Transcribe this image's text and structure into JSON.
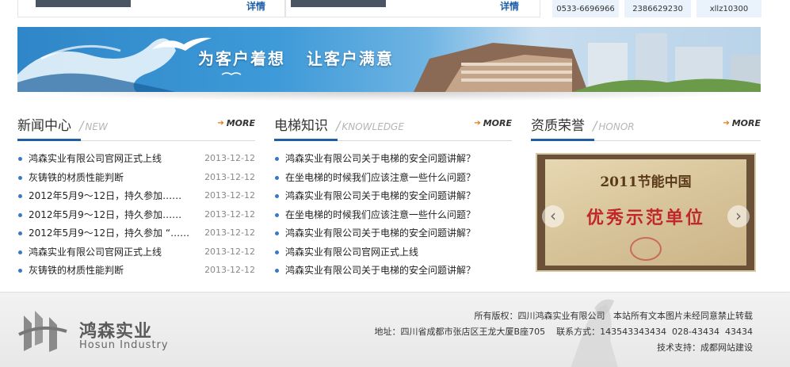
{
  "top_strip": {
    "detail_label": "详情",
    "contacts": [
      "0533-6696966",
      "2386629230",
      "xllz10300"
    ]
  },
  "banner": {
    "slogan_left": "为客户着想",
    "slogan_right": "让客户满意"
  },
  "news": {
    "title": "新闻中心",
    "subtitle": "NEW",
    "more_label": "MORE",
    "items": [
      {
        "text": "鸿森实业有限公司官网正式上线",
        "date": "2013-12-12"
      },
      {
        "text": "灰铸铁的材质性能判断",
        "date": "2013-12-12"
      },
      {
        "text": "2012年5月9～12日，持久参加……",
        "date": "2013-12-12"
      },
      {
        "text": "2012年5月9～12日，持久参加……",
        "date": "2013-12-12"
      },
      {
        "text": "2012年5月9～12日，持久参加 “……",
        "date": "2013-12-12"
      },
      {
        "text": "鸿森实业有限公司官网正式上线",
        "date": "2013-12-12"
      },
      {
        "text": "灰铸铁的材质性能判断",
        "date": "2013-12-12"
      }
    ]
  },
  "knowledge": {
    "title": "电梯知识",
    "subtitle": "KNOWLEDGE",
    "more_label": "MORE",
    "items": [
      "鸿森实业有限公司关于电梯的安全问题讲解？",
      "在坐电梯的时候我们应该注意一些什么问题？",
      "鸿森实业有限公司关于电梯的安全问题讲解？",
      "在坐电梯的时候我们应该注意一些什么问题？",
      "鸿森实业有限公司关于电梯的安全问题讲解？",
      "鸿森实业有限公司官网正式上线",
      "鸿森实业有限公司关于电梯的安全问题讲解？"
    ]
  },
  "honor": {
    "title": "资质荣誉",
    "subtitle": "HONOR",
    "more_label": "MORE",
    "plaque_title": "2011节能中国",
    "plaque_main": "优秀示范单位",
    "prev_symbol": "‹",
    "next_symbol": "›"
  },
  "footer": {
    "logo_cn": "鸿森实业",
    "logo_en": "Hosun Industry",
    "copyright": "所有版权：四川鸿森实业有限公司   本站所有文本图片未经同意禁止转载",
    "address": "地址：四川省成都市张店区王龙大厦B座705    联系方式：143543343434  028-43434  43434",
    "support": "技术支持：成都网站建设"
  },
  "colors": {
    "accent_blue": "#1f5fa6",
    "more_arrow": "#e07a16",
    "bullet": "#3a78c3"
  }
}
